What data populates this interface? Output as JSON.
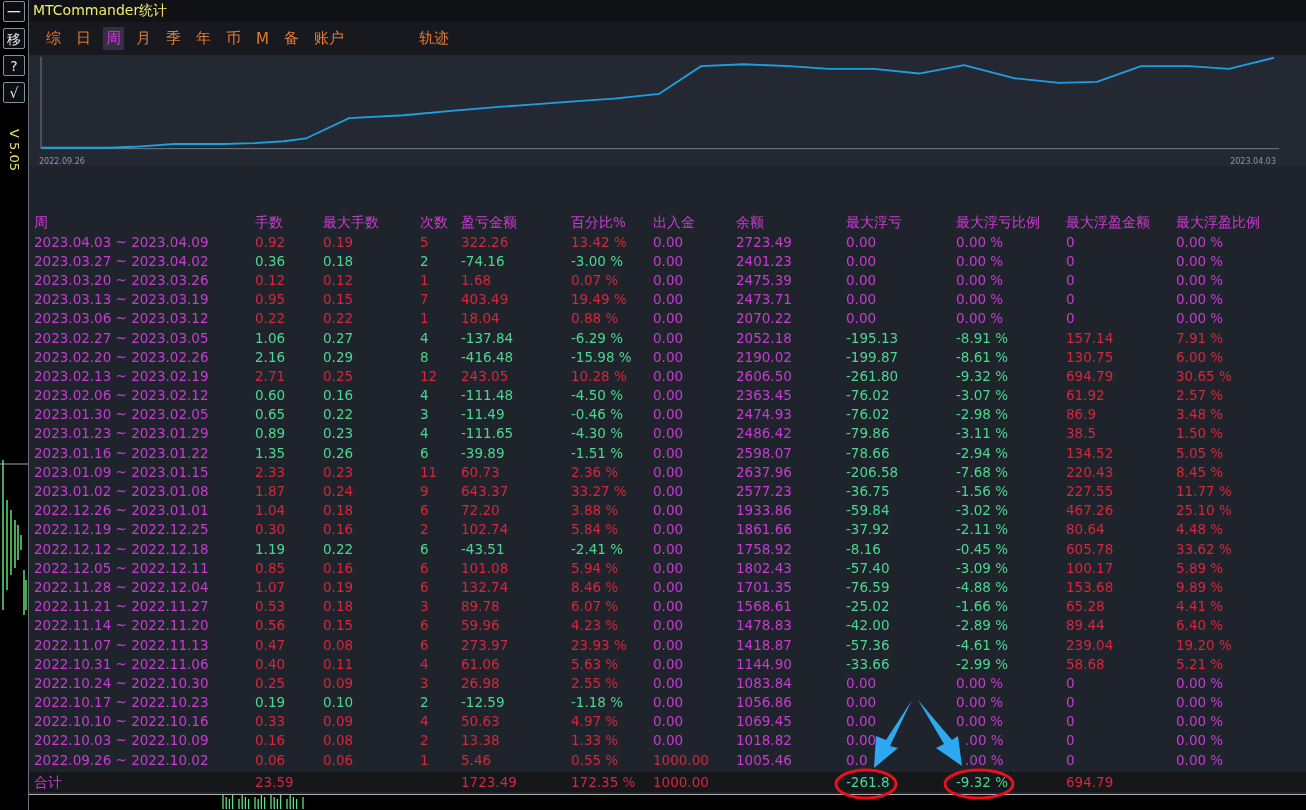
{
  "side_buttons": [
    "一",
    "移",
    "?",
    "√"
  ],
  "version": "V 5.05",
  "window": {
    "title": "MTCommander统计"
  },
  "tabs": [
    {
      "label": "综",
      "selected": false
    },
    {
      "label": "日",
      "selected": false
    },
    {
      "label": "周",
      "selected": true
    },
    {
      "label": "月",
      "selected": false
    },
    {
      "label": "季",
      "selected": false
    },
    {
      "label": "年",
      "selected": false
    },
    {
      "label": "币",
      "selected": false
    },
    {
      "label": "M",
      "selected": false
    },
    {
      "label": "备",
      "selected": false
    },
    {
      "label": "账户",
      "selected": false
    },
    {
      "label": "轨迹",
      "selected": false
    }
  ],
  "chart": {
    "start_label": "2022.09.26",
    "end_label": "2023.04.03"
  },
  "table": {
    "columns": [
      "周",
      "手数",
      "最大手数",
      "次数",
      "盈亏金额",
      "百分比%",
      "出入金",
      "余额",
      "最大浮亏",
      "最大浮亏比例",
      "最大浮盈金额",
      "最大浮盈比例"
    ],
    "rows": [
      {
        "cells": [
          "2023.04.03 ~ 2023.04.09",
          "0.92",
          "0.19",
          "5",
          "322.26",
          "13.42 %",
          "0.00",
          "2723.49",
          "0.00",
          "0.00 %",
          "0",
          "0.00 %"
        ],
        "losing": false,
        "deposit_made": false,
        "floating": false
      },
      {
        "cells": [
          "2023.03.27 ~ 2023.04.02",
          "0.36",
          "0.18",
          "2",
          "-74.16",
          "-3.00 %",
          "0.00",
          "2401.23",
          "0.00",
          "0.00 %",
          "0",
          "0.00 %"
        ],
        "losing": true,
        "deposit_made": false,
        "floating": false
      },
      {
        "cells": [
          "2023.03.20 ~ 2023.03.26",
          "0.12",
          "0.12",
          "1",
          "1.68",
          "0.07 %",
          "0.00",
          "2475.39",
          "0.00",
          "0.00 %",
          "0",
          "0.00 %"
        ],
        "losing": false,
        "deposit_made": false,
        "floating": false
      },
      {
        "cells": [
          "2023.03.13 ~ 2023.03.19",
          "0.95",
          "0.15",
          "7",
          "403.49",
          "19.49 %",
          "0.00",
          "2473.71",
          "0.00",
          "0.00 %",
          "0",
          "0.00 %"
        ],
        "losing": false,
        "deposit_made": false,
        "floating": false
      },
      {
        "cells": [
          "2023.03.06 ~ 2023.03.12",
          "0.22",
          "0.22",
          "1",
          "18.04",
          "0.88 %",
          "0.00",
          "2070.22",
          "0.00",
          "0.00 %",
          "0",
          "0.00 %"
        ],
        "losing": false,
        "deposit_made": false,
        "floating": false
      },
      {
        "cells": [
          "2023.02.27 ~ 2023.03.05",
          "1.06",
          "0.27",
          "4",
          "-137.84",
          "-6.29 %",
          "0.00",
          "2052.18",
          "-195.13",
          "-8.91 %",
          "157.14",
          "7.91 %"
        ],
        "losing": true,
        "deposit_made": false,
        "floating": true
      },
      {
        "cells": [
          "2023.02.20 ~ 2023.02.26",
          "2.16",
          "0.29",
          "8",
          "-416.48",
          "-15.98 %",
          "0.00",
          "2190.02",
          "-199.87",
          "-8.61 %",
          "130.75",
          "6.00 %"
        ],
        "losing": true,
        "deposit_made": false,
        "floating": true
      },
      {
        "cells": [
          "2023.02.13 ~ 2023.02.19",
          "2.71",
          "0.25",
          "12",
          "243.05",
          "10.28 %",
          "0.00",
          "2606.50",
          "-261.80",
          "-9.32 %",
          "694.79",
          "30.65 %"
        ],
        "losing": false,
        "deposit_made": false,
        "floating": true
      },
      {
        "cells": [
          "2023.02.06 ~ 2023.02.12",
          "0.60",
          "0.16",
          "4",
          "-111.48",
          "-4.50 %",
          "0.00",
          "2363.45",
          "-76.02",
          "-3.07 %",
          "61.92",
          "2.57 %"
        ],
        "losing": true,
        "deposit_made": false,
        "floating": true
      },
      {
        "cells": [
          "2023.01.30 ~ 2023.02.05",
          "0.65",
          "0.22",
          "3",
          "-11.49",
          "-0.46 %",
          "0.00",
          "2474.93",
          "-76.02",
          "-2.98 %",
          "86.9",
          "3.48 %"
        ],
        "losing": true,
        "deposit_made": false,
        "floating": true
      },
      {
        "cells": [
          "2023.01.23 ~ 2023.01.29",
          "0.89",
          "0.23",
          "4",
          "-111.65",
          "-4.30 %",
          "0.00",
          "2486.42",
          "-79.86",
          "-3.11 %",
          "38.5",
          "1.50 %"
        ],
        "losing": true,
        "deposit_made": false,
        "floating": true
      },
      {
        "cells": [
          "2023.01.16 ~ 2023.01.22",
          "1.35",
          "0.26",
          "6",
          "-39.89",
          "-1.51 %",
          "0.00",
          "2598.07",
          "-78.66",
          "-2.94 %",
          "134.52",
          "5.05 %"
        ],
        "losing": true,
        "deposit_made": false,
        "floating": true
      },
      {
        "cells": [
          "2023.01.09 ~ 2023.01.15",
          "2.33",
          "0.23",
          "11",
          "60.73",
          "2.36 %",
          "0.00",
          "2637.96",
          "-206.58",
          "-7.68 %",
          "220.43",
          "8.45 %"
        ],
        "losing": false,
        "deposit_made": false,
        "floating": true
      },
      {
        "cells": [
          "2023.01.02 ~ 2023.01.08",
          "1.87",
          "0.24",
          "9",
          "643.37",
          "33.27 %",
          "0.00",
          "2577.23",
          "-36.75",
          "-1.56 %",
          "227.55",
          "11.77 %"
        ],
        "losing": false,
        "deposit_made": false,
        "floating": true
      },
      {
        "cells": [
          "2022.12.26 ~ 2023.01.01",
          "1.04",
          "0.18",
          "6",
          "72.20",
          "3.88 %",
          "0.00",
          "1933.86",
          "-59.84",
          "-3.02 %",
          "467.26",
          "25.10 %"
        ],
        "losing": false,
        "deposit_made": false,
        "floating": true
      },
      {
        "cells": [
          "2022.12.19 ~ 2022.12.25",
          "0.30",
          "0.16",
          "2",
          "102.74",
          "5.84 %",
          "0.00",
          "1861.66",
          "-37.92",
          "-2.11 %",
          "80.64",
          "4.48 %"
        ],
        "losing": false,
        "deposit_made": false,
        "floating": true
      },
      {
        "cells": [
          "2022.12.12 ~ 2022.12.18",
          "1.19",
          "0.22",
          "6",
          "-43.51",
          "-2.41 %",
          "0.00",
          "1758.92",
          "-8.16",
          "-0.45 %",
          "605.78",
          "33.62 %"
        ],
        "losing": true,
        "deposit_made": false,
        "floating": true
      },
      {
        "cells": [
          "2022.12.05 ~ 2022.12.11",
          "0.85",
          "0.16",
          "6",
          "101.08",
          "5.94 %",
          "0.00",
          "1802.43",
          "-57.40",
          "-3.09 %",
          "100.17",
          "5.89 %"
        ],
        "losing": false,
        "deposit_made": false,
        "floating": true
      },
      {
        "cells": [
          "2022.11.28 ~ 2022.12.04",
          "1.07",
          "0.19",
          "6",
          "132.74",
          "8.46 %",
          "0.00",
          "1701.35",
          "-76.59",
          "-4.88 %",
          "153.68",
          "9.89 %"
        ],
        "losing": false,
        "deposit_made": false,
        "floating": true
      },
      {
        "cells": [
          "2022.11.21 ~ 2022.11.27",
          "0.53",
          "0.18",
          "3",
          "89.78",
          "6.07 %",
          "0.00",
          "1568.61",
          "-25.02",
          "-1.66 %",
          "65.28",
          "4.41 %"
        ],
        "losing": false,
        "deposit_made": false,
        "floating": true
      },
      {
        "cells": [
          "2022.11.14 ~ 2022.11.20",
          "0.56",
          "0.15",
          "6",
          "59.96",
          "4.23 %",
          "0.00",
          "1478.83",
          "-42.00",
          "-2.89 %",
          "89.44",
          "6.40 %"
        ],
        "losing": false,
        "deposit_made": false,
        "floating": true
      },
      {
        "cells": [
          "2022.11.07 ~ 2022.11.13",
          "0.47",
          "0.08",
          "6",
          "273.97",
          "23.93 %",
          "0.00",
          "1418.87",
          "-57.36",
          "-4.61 %",
          "239.04",
          "19.20 %"
        ],
        "losing": false,
        "deposit_made": false,
        "floating": true
      },
      {
        "cells": [
          "2022.10.31 ~ 2022.11.06",
          "0.40",
          "0.11",
          "4",
          "61.06",
          "5.63 %",
          "0.00",
          "1144.90",
          "-33.66",
          "-2.99 %",
          "58.68",
          "5.21 %"
        ],
        "losing": false,
        "deposit_made": false,
        "floating": true
      },
      {
        "cells": [
          "2022.10.24 ~ 2022.10.30",
          "0.25",
          "0.09",
          "3",
          "26.98",
          "2.55 %",
          "0.00",
          "1083.84",
          "0.00",
          "0.00 %",
          "0",
          "0.00 %"
        ],
        "losing": false,
        "deposit_made": false,
        "floating": false
      },
      {
        "cells": [
          "2022.10.17 ~ 2022.10.23",
          "0.19",
          "0.10",
          "2",
          "-12.59",
          "-1.18 %",
          "0.00",
          "1056.86",
          "0.00",
          "0.00 %",
          "0",
          "0.00 %"
        ],
        "losing": true,
        "deposit_made": false,
        "floating": false
      },
      {
        "cells": [
          "2022.10.10 ~ 2022.10.16",
          "0.33",
          "0.09",
          "4",
          "50.63",
          "4.97 %",
          "0.00",
          "1069.45",
          "0.00",
          "0.00 %",
          "0",
          "0.00 %"
        ],
        "losing": false,
        "deposit_made": false,
        "floating": false
      },
      {
        "cells": [
          "2022.10.03 ~ 2022.10.09",
          "0.16",
          "0.08",
          "2",
          "13.38",
          "1.33 %",
          "0.00",
          "1018.82",
          "0.00",
          ".00 %",
          "0",
          "0.00 %"
        ],
        "losing": false,
        "deposit_made": false,
        "floating": false
      },
      {
        "cells": [
          "2022.09.26 ~ 2022.10.02",
          "0.06",
          "0.06",
          "1",
          "5.46",
          "0.55 %",
          "1000.00",
          "1005.46",
          "0.0",
          ".00 %",
          "0",
          "0.00 %"
        ],
        "losing": false,
        "deposit_made": true,
        "floating": false
      }
    ],
    "total": {
      "label": "合计",
      "lots": "23.59",
      "pnl": "1723.49",
      "pct": "172.35 %",
      "deposit": "1000.00",
      "max_float_loss": "-261.8",
      "max_float_loss_pct": "-9.32 %",
      "max_float_profit": "694.79"
    }
  }
}
